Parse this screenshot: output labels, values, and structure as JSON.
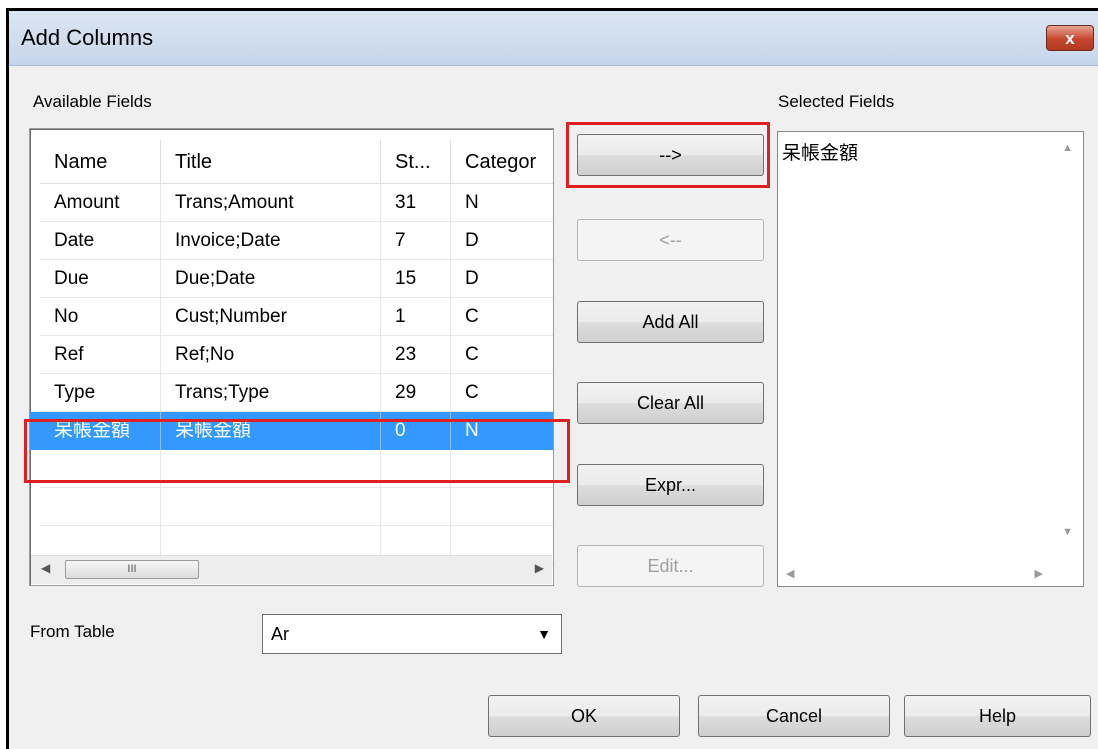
{
  "window": {
    "title": "Add Columns",
    "close_label": "x"
  },
  "available_fields": {
    "label": "Available Fields",
    "columns": [
      "Name",
      "Title",
      "St...",
      "Categor"
    ],
    "rows": [
      [
        "Amount",
        "Trans;Amount",
        "31",
        "N"
      ],
      [
        "Date",
        "Invoice;Date",
        "7",
        "D"
      ],
      [
        "Due",
        "Due;Date",
        "15",
        "D"
      ],
      [
        "No",
        "Cust;Number",
        "1",
        "C"
      ],
      [
        "Ref",
        "Ref;No",
        "23",
        "C"
      ],
      [
        "Type",
        "Trans;Type",
        "29",
        "C"
      ],
      [
        "呆帳金額",
        "呆帳金額",
        "0",
        "N"
      ]
    ],
    "selected_row": 6,
    "scroll_left": "◀",
    "scroll_right": "▶",
    "scroll_thumb": "III"
  },
  "buttons": {
    "add": "-->",
    "remove": "<--",
    "add_all": "Add All",
    "clear_all": "Clear All",
    "expr": "Expr...",
    "edit": "Edit...",
    "ok": "OK",
    "cancel": "Cancel",
    "help": "Help"
  },
  "selected_fields": {
    "label": "Selected Fields",
    "items": [
      "呆帳金額"
    ],
    "scroll_up": "▲",
    "scroll_down": "▼",
    "scroll_left": "◀",
    "scroll_right": "▶"
  },
  "from_table": {
    "label": "From Table",
    "value": "Ar",
    "dropdown_icon": "▼"
  },
  "highlight_color": "#e02020",
  "selection_color": "#3399ff"
}
